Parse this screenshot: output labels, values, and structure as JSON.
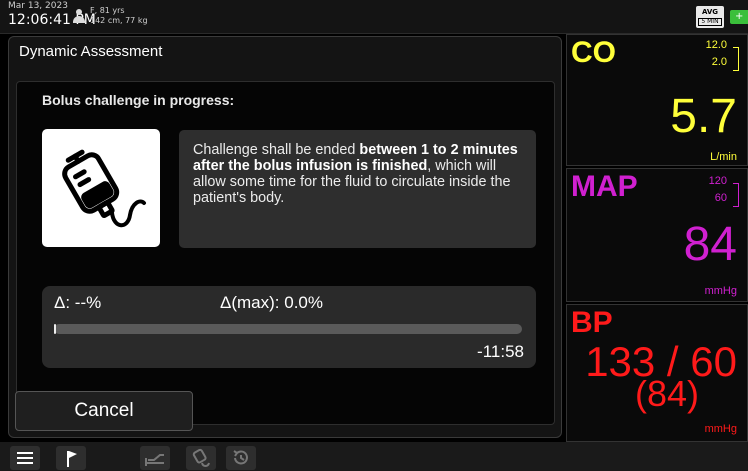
{
  "status_bar": {
    "date": "Mar 13, 2023",
    "time": "12:06:41 PM",
    "patient_line1": "F, 81 yrs",
    "patient_line2": "142 cm, 77 kg",
    "avg_label": "AVG",
    "avg_interval": "5 MIN",
    "battery_icon": "battery-charging-icon"
  },
  "panel": {
    "title": "Dynamic Assessment",
    "subtitle": "Bolus challenge in progress:",
    "info_part1": "Challenge shall be ended ",
    "info_bold1": "between 1 to 2 minutes after the bolus infusion is finished",
    "info_part2": ", which will allow some time for the fluid to circulate inside the patient's body.",
    "delta_label": "Δ: --%",
    "delta_max_label": "Δ(max): 0.0%",
    "progress": 0.0,
    "remaining": "-11:58",
    "cancel_label": "Cancel"
  },
  "vitals": {
    "co": {
      "name": "CO",
      "upper": "12.0",
      "lower": "2.0",
      "value": "5.7",
      "unit": "L/min",
      "color": "#ffff3a"
    },
    "map": {
      "name": "MAP",
      "upper": "120",
      "lower": "60",
      "value": "84",
      "unit": "mmHg",
      "color": "#d020d0"
    },
    "bp": {
      "name": "BP",
      "value": "133 / 60",
      "mean": "(84)",
      "unit": "mmHg",
      "color": "#ff1a1a"
    }
  },
  "bottom_bar": {
    "icons": [
      "menu-icon",
      "flag-icon",
      "bed-icon",
      "bag-icon",
      "history-icon"
    ]
  }
}
